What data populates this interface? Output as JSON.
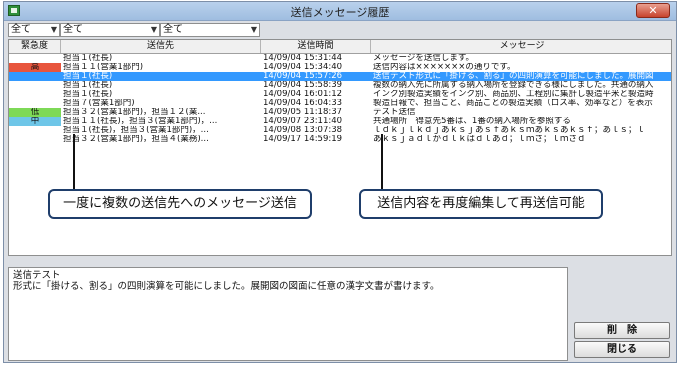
{
  "window": {
    "title": "送信メッセージ履歴",
    "close_label": "✕"
  },
  "filters": [
    {
      "value": "全て"
    },
    {
      "value": "全て"
    },
    {
      "value": "全て"
    }
  ],
  "table": {
    "headers": [
      "緊急度",
      "送信先",
      "送信時間",
      "メッセージ"
    ],
    "rows": [
      {
        "priority": "",
        "dest": "担当１(社長)",
        "time": "14/09/04 15:31:44",
        "message": "メッセージを送信します。"
      },
      {
        "priority": "高",
        "dest": "担当１１(営業1部門)",
        "time": "14/09/04 15:34:40",
        "message": "送信内容は×××××××の通りです。"
      },
      {
        "priority": "",
        "dest": "担当１(社長)",
        "time": "14/09/04 15:57:26",
        "message": "送信テスト形式に「掛ける、割る」の四則演算を可能にしました。展開図"
      },
      {
        "priority": "",
        "dest": "担当１(社長)",
        "time": "14/09/04 15:58:39",
        "message": "複数の納入先に所属する納入場所を登録できる様にしました。共通の納入"
      },
      {
        "priority": "",
        "dest": "担当１(社長)",
        "time": "14/09/04 16:01:12",
        "message": "インク別製造実績をインク別、商品別、工程別に集計し製造平米と製造時"
      },
      {
        "priority": "",
        "dest": "担当７(営業1部門)",
        "time": "14/09/04 16:04:33",
        "message": "製造日報で、担当ごと、商品ごとの製造実績（ロス率、効率など）を表示"
      },
      {
        "priority": "低",
        "dest": "担当３２(営業1部門)，担当１２(業...",
        "time": "14/09/05 11:18:37",
        "message": "テスト送信"
      },
      {
        "priority": "中",
        "dest": "担当１１(社長)，担当３(営業1部門)，...",
        "time": "14/09/07 23:11:40",
        "message": "共通場所　得意先5番は、1番の納入場所を参照する"
      },
      {
        "priority": "",
        "dest": "担当１(社長)，担当３(営業1部門)，...",
        "time": "14/09/08 13:07:38",
        "message": "ｌｄｋｊｌｋｄｊあｋｓｊあｓｆあｋｓｍあｋｓあｋｓｆ；あｌｓ；ｌ"
      },
      {
        "priority": "",
        "dest": "担当３２(営業1部門)，担当４(業務)...",
        "time": "14/09/17 14:59:19",
        "message": "あｋｓｊａｄｌかｄｌｋはｄｌあｄ；ｌｍさ；ｌｍさｄ"
      }
    ]
  },
  "colors": {
    "high": "#e8553d",
    "low": "#7ed957",
    "mid": "#6ec6e8",
    "selected": "#3399ff"
  },
  "callouts": {
    "left": "一度に複数の送信先へのメッセージ送信",
    "right": "送信内容を再度編集して再送信可能"
  },
  "detail": {
    "line1": "送信テスト",
    "line2": "形式に「掛ける、割る」の四則演算を可能にしました。展開図の図面に任意の漢字文書が書けます。"
  },
  "buttons": {
    "delete_label": "削　除",
    "close_label": "閉じる"
  }
}
